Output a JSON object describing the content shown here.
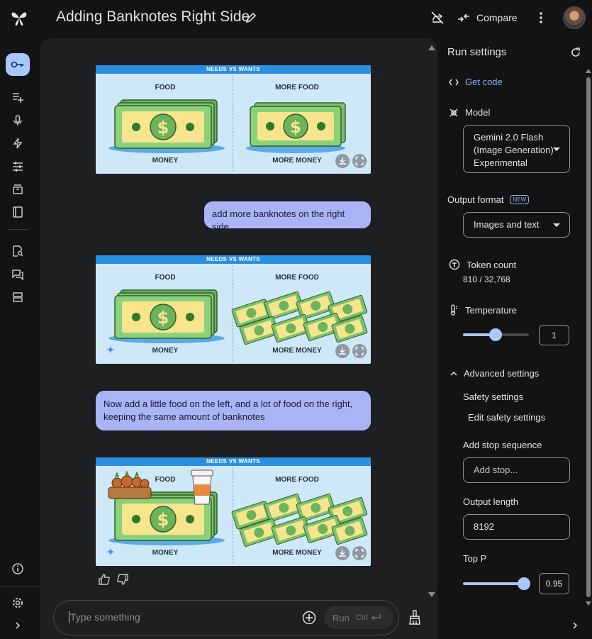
{
  "header": {
    "title": "Adding Banknotes Right Side",
    "compare_label": "Compare",
    "icons": [
      "logo-icon",
      "edit-icon",
      "stop-sharing-icon",
      "compare-icon",
      "more-vert-icon",
      "avatar"
    ]
  },
  "rail": {
    "items": [
      "key-icon",
      "new-prompt-icon",
      "mic-icon",
      "bolt-icon",
      "tune-icon",
      "library-icon",
      "docs-icon",
      "search-doc-icon",
      "chat-icon",
      "storage-icon",
      "info-icon",
      "settings-icon",
      "expand-icon"
    ]
  },
  "chat": {
    "images": [
      {
        "header": "NEEDS VS WANTS",
        "left_top": "FOOD",
        "right_top": "MORE FOOD",
        "left_bottom": "MONEY",
        "right_bottom": "MORE MONEY"
      },
      {
        "header": "NEEDS VS WANTS",
        "left_top": "FOOD",
        "right_top": "MORE FOOD",
        "left_bottom": "MONEY",
        "right_bottom": "MORE MONEY"
      },
      {
        "header": "NEEDS VS WANTS",
        "left_top": "FOOD",
        "right_top": "MORE FOOD",
        "left_bottom": "MONEY",
        "right_bottom": "MORE MONEY"
      }
    ],
    "messages": [
      "add more banknotes on the right side",
      "Now add a little food on the left, and a lot of food on the right, keeping the same amount of banknotes"
    ]
  },
  "input": {
    "placeholder": "Type something",
    "run_label": "Run",
    "shortcut": "Ctrl"
  },
  "settings": {
    "title": "Run settings",
    "get_code": "Get code",
    "model_label": "Model",
    "model_value": [
      "Gemini 2.0 Flash",
      "(Image Generation)",
      "Experimental"
    ],
    "output_format_label": "Output format",
    "new_badge": "NEW",
    "output_format_value": "Images and text",
    "token_count_label": "Token count",
    "token_count_value": "810 / 32,768",
    "temperature_label": "Temperature",
    "temperature_value": "1",
    "temperature_fraction": 0.5,
    "advanced_label": "Advanced settings",
    "safety_label": "Safety settings",
    "edit_safety": "Edit safety settings",
    "stop_seq_label": "Add stop sequence",
    "stop_seq_placeholder": "Add stop...",
    "output_length_label": "Output length",
    "output_length_value": "8192",
    "top_p_label": "Top P",
    "top_p_value": "0.95"
  },
  "colors": {
    "accent": "#a8c7fa",
    "link": "#8ab4f8",
    "user_bubble": "#a9b3f5",
    "banknote_green": "#7cc36c",
    "banknote_yellow": "#f6e58d"
  }
}
